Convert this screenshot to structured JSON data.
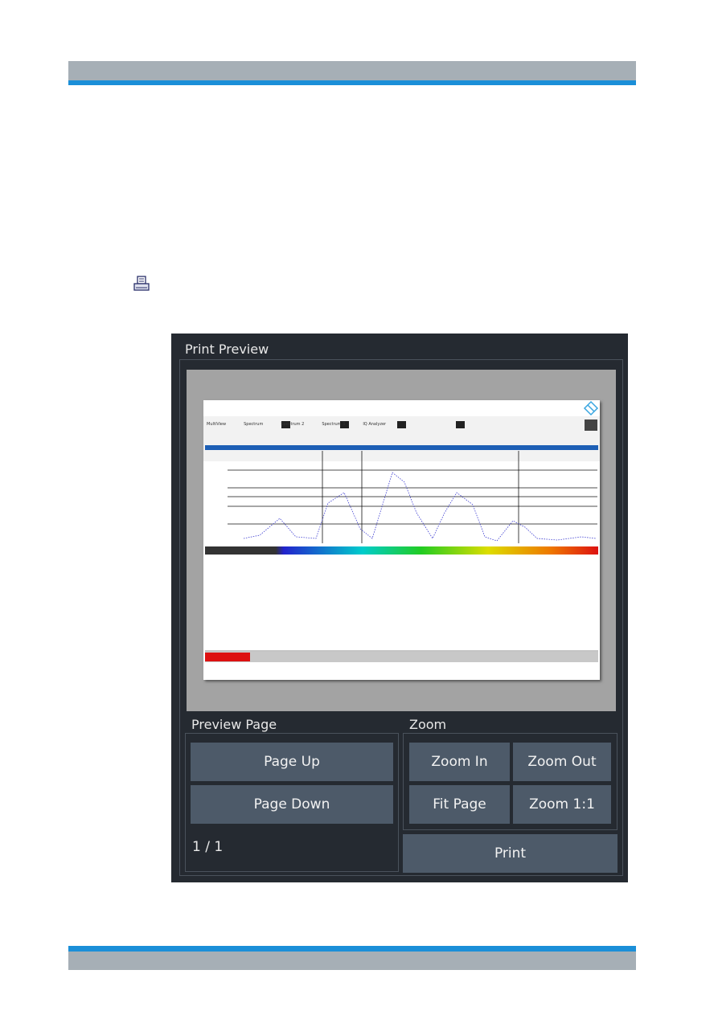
{
  "dialog": {
    "title": "Print Preview",
    "preview_page": {
      "label": "Preview Page",
      "page_up": "Page Up",
      "page_down": "Page Down",
      "page_indicator": "1 / 1"
    },
    "zoom": {
      "label": "Zoom",
      "zoom_in": "Zoom In",
      "zoom_out": "Zoom Out",
      "fit_page": "Fit Page",
      "zoom_1_1": "Zoom 1:1"
    },
    "print": "Print",
    "preview": {
      "tabs": [
        "MultiView",
        "Spectrum",
        "Spectrum 2",
        "Spectrum 3",
        "IQ Analyzer"
      ]
    }
  },
  "icons": {
    "print_icon": "printer-icon"
  },
  "colors": {
    "accent": "#1b8fd8",
    "header_gray": "#a6afb6",
    "dialog_bg": "#252a31",
    "button": "#4d5a69"
  }
}
